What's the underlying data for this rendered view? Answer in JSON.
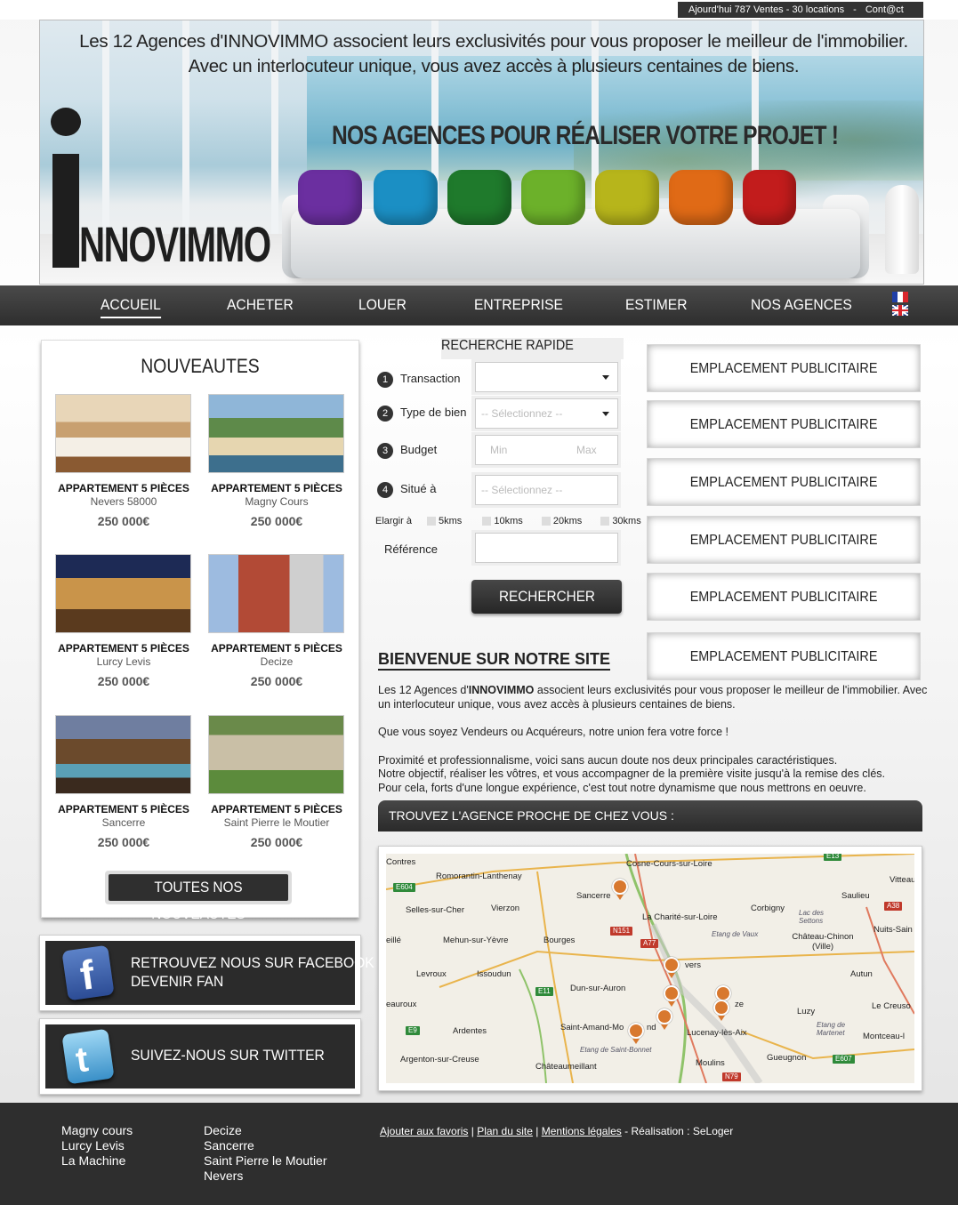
{
  "topbar": {
    "stats": "Ajourd'hui 787 Ventes - 30 locations",
    "separator": "-",
    "contact": "Cont@ct"
  },
  "banner": {
    "tagline_1": "Les 12 Agences d'INNOVIMMO associent leurs exclusivités pour vous proposer le meilleur de l'immobilier.",
    "tagline_2": "Avec un interlocuteur unique, vous avez accès à plusieurs centaines de biens.",
    "slogan": "NOS AGENCES POUR RÉALISER VOTRE PROJET !",
    "logo_text": "NNOVIMMO"
  },
  "nav": {
    "items": [
      "ACCUEIL",
      "ACHETER",
      "LOUER",
      "ENTREPRISE",
      "ESTIMER",
      "NOS AGENCES"
    ],
    "active": "ACCUEIL"
  },
  "news": {
    "title": "NOUVEAUTES",
    "cards": [
      {
        "title": "APPARTEMENT 5 PIÈCES",
        "location": "Nevers 58000",
        "price": "250 000€"
      },
      {
        "title": "APPARTEMENT 5 PIÈCES",
        "location": "Magny Cours",
        "price": "250 000€"
      },
      {
        "title": "APPARTEMENT 5 PIÈCES",
        "location": "Lurcy Levis",
        "price": "250 000€"
      },
      {
        "title": "APPARTEMENT 5 PIÈCES",
        "location": "Decize",
        "price": "250 000€"
      },
      {
        "title": "APPARTEMENT 5 PIÈCES",
        "location": "Sancerre",
        "price": "250 000€"
      },
      {
        "title": "APPARTEMENT 5 PIÈCES",
        "location": "Saint Pierre le Moutier",
        "price": "250 000€"
      }
    ],
    "all_button": "TOUTES NOS NOUVEAUTÉS"
  },
  "social": {
    "facebook_line1": "RETROUVEZ NOUS SUR FACEBOOK",
    "facebook_line2": "DEVENIR FAN",
    "twitter": "SUIVEZ-NOUS SUR TWITTER"
  },
  "search": {
    "title": "RECHERCHE RAPIDE",
    "transaction_label": "Transaction",
    "type_label": "Type de bien",
    "type_placeholder": "-- Sélectionnez --",
    "budget_label": "Budget",
    "budget_min": "Min",
    "budget_max": "Max",
    "situe_label": "Situé à",
    "situe_placeholder": "-- Sélectionnez --",
    "elargir_label": "Elargir à",
    "radius": [
      "5kms",
      "10kms",
      "20kms",
      "30kms"
    ],
    "reference_label": "Référence",
    "submit": "RECHERCHER"
  },
  "ads": {
    "label": "EMPLACEMENT PUBLICITAIRE"
  },
  "welcome": {
    "title": "BIENVENUE SUR NOTRE SITE",
    "p1_before": "Les 12 Agences d'",
    "p1_brand": "INNOVIMMO",
    "p1_after": " associent leurs exclusivités pour vous proposer le meilleur de l'immobilier. Avec un interlocuteur unique, vous avez accès à plusieurs centaines de biens.",
    "p2": "Que vous soyez Vendeurs ou Acquéreurs, notre union fera votre force !",
    "p3_1": "Proximité et professionnalisme, voici sans aucun doute nos deux principales caractéristiques.",
    "p3_2": "Notre objectif, réaliser les vôtres, et vous accompagner de la première visite jusqu'à la remise des clés.",
    "p3_3": "Pour cela, forts d'une longue expérience,  c'est tout notre dynamisme que nous mettrons en oeuvre."
  },
  "agency_finder": {
    "title": "TROUVEZ L'AGENCE PROCHE DE CHEZ VOUS :"
  },
  "map": {
    "places": [
      "Contres",
      "Romorantin-Lanthenay",
      "Cosne-Cours-sur-Loire",
      "Sancerre",
      "Vitteau",
      "Saulieu",
      "Selles-sur-Cher",
      "Vierzon",
      "La Charité-sur-Loire",
      "Corbigny",
      "Lac des Settons",
      "Nuits-Sain",
      "eillé",
      "Mehun-sur-Yèvre",
      "Bourges",
      "Etang de Vaux",
      "Château-Chinon (Ville)",
      "Levroux",
      "Issoudun",
      "vers",
      "Autun",
      "Dun-sur-Auron",
      "ze",
      "eauroux",
      "Luzy",
      "Le Creuso",
      "Ardentes",
      "Saint-Amand-Mo",
      "nd",
      "Lucenay-lès-Aix",
      "Etang de Martenet",
      "Montceau-l",
      "Etang de Saint-Bonnet",
      "Gueugnon",
      "Argenton-sur-Creuse",
      "Châteaumeillant",
      "Moulins"
    ],
    "roads": [
      "E13",
      "E604",
      "A38",
      "N151",
      "A77",
      "E11",
      "E9",
      "E607",
      "N79"
    ]
  },
  "footer": {
    "col1": [
      "Magny cours",
      "Lurcy Levis",
      "La Machine"
    ],
    "col2": [
      "Decize",
      "Sancerre",
      "Saint Pierre le Moutier",
      "Nevers"
    ],
    "link_favoris": "Ajouter aux favoris",
    "link_plan": "Plan du site",
    "link_mentions": "Mentions légales",
    "realisation": "- Réalisation  :  SeLoger",
    "sep": "|"
  },
  "colors": {
    "dark": "#2e2e2e",
    "pin": "#d8782e",
    "pillows": [
      "#6b2fa0",
      "#1b8fc4",
      "#1f7a2c",
      "#6cb12a",
      "#b7b51b",
      "#e06a16",
      "#c21c1c"
    ]
  }
}
